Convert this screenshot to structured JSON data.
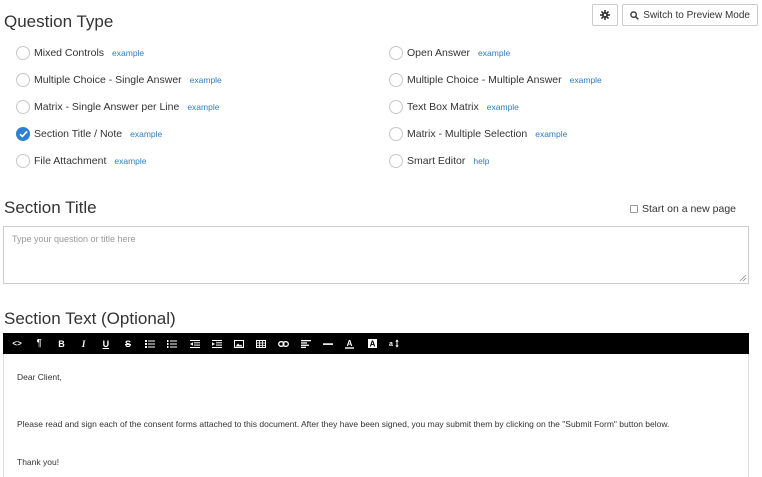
{
  "question_type": {
    "heading": "Question Type",
    "settings_icon": "gear-icon",
    "preview_button": {
      "icon": "search-icon",
      "label": "Switch to Preview Mode"
    },
    "options_left": [
      {
        "label": "Mixed Controls",
        "link": "example",
        "checked": false
      },
      {
        "label": "Multiple Choice - Single Answer",
        "link": "example",
        "checked": false
      },
      {
        "label": "Matrix - Single Answer per Line",
        "link": "example",
        "checked": false
      },
      {
        "label": "Section Title / Note",
        "link": "example",
        "checked": true
      },
      {
        "label": "File Attachment",
        "link": "example",
        "checked": false
      }
    ],
    "options_right": [
      {
        "label": "Open Answer",
        "link": "example",
        "checked": false
      },
      {
        "label": "Multiple Choice - Multiple Answer",
        "link": "example",
        "checked": false
      },
      {
        "label": "Text Box Matrix",
        "link": "example",
        "checked": false
      },
      {
        "label": "Matrix - Multiple Selection",
        "link": "example",
        "checked": false
      },
      {
        "label": "Smart Editor",
        "link": "help",
        "checked": false
      }
    ]
  },
  "section_title": {
    "heading": "Section Title",
    "new_page_label": "Start on a new page",
    "new_page_checked": false,
    "placeholder": "Type your question or title here"
  },
  "section_text": {
    "heading": "Section Text (Optional)",
    "toolbar": [
      {
        "icon": "code-view-icon",
        "glyph": "<>"
      },
      {
        "icon": "paragraph-icon",
        "glyph": "¶"
      },
      {
        "icon": "bold-icon",
        "glyph": "B"
      },
      {
        "icon": "italic-icon",
        "glyph": "I"
      },
      {
        "icon": "underline-icon",
        "glyph": "U"
      },
      {
        "icon": "strikethrough-icon",
        "glyph": "S"
      },
      {
        "icon": "unordered-list-icon",
        "glyph": ""
      },
      {
        "icon": "ordered-list-icon",
        "glyph": ""
      },
      {
        "icon": "outdent-icon",
        "glyph": ""
      },
      {
        "icon": "indent-icon",
        "glyph": ""
      },
      {
        "icon": "image-icon",
        "glyph": ""
      },
      {
        "icon": "table-icon",
        "glyph": ""
      },
      {
        "icon": "link-icon",
        "glyph": ""
      },
      {
        "icon": "align-icon",
        "glyph": ""
      },
      {
        "icon": "horizontal-rule-icon",
        "glyph": ""
      },
      {
        "icon": "font-color-icon",
        "glyph": "A"
      },
      {
        "icon": "background-color-icon",
        "glyph": "A"
      },
      {
        "icon": "font-size-icon",
        "glyph": "a"
      }
    ],
    "paragraphs": [
      "Dear Client,",
      "Please read and sign each of the consent forms attached to this document. After they have been signed, you may submit them by clicking on  the \"Submit Form\" button below.",
      "Thank you!"
    ]
  },
  "colors": {
    "accent": "#2f80d1",
    "link": "#2f7cc4",
    "toolbar_bg": "#000000"
  }
}
